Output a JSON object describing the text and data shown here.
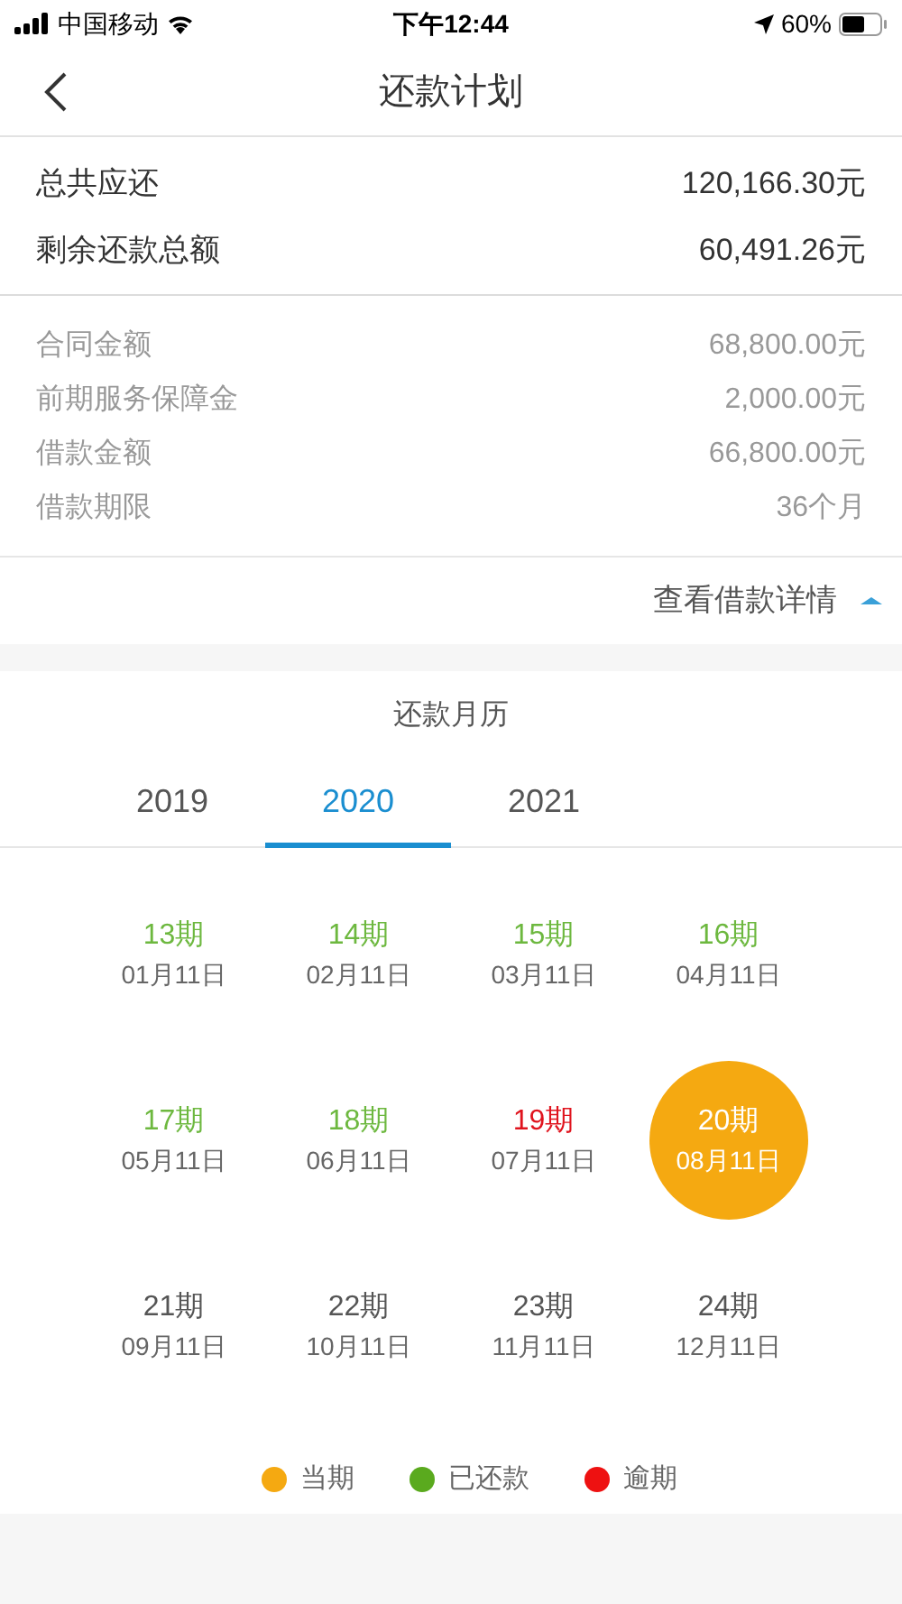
{
  "status_bar": {
    "carrier": "中国移动",
    "time": "下午12:44",
    "battery": "60%"
  },
  "nav": {
    "title": "还款计划"
  },
  "summary": [
    {
      "label": "总共应还",
      "value": "120,166.30元"
    },
    {
      "label": "剩余还款总额",
      "value": "60,491.26元"
    }
  ],
  "details": [
    {
      "label": "合同金额",
      "value": "68,800.00元"
    },
    {
      "label": "前期服务保障金",
      "value": "2,000.00元"
    },
    {
      "label": "借款金额",
      "value": "66,800.00元"
    },
    {
      "label": "借款期限",
      "value": "36个月"
    }
  ],
  "details_toggle": {
    "label": "查看借款详情",
    "expanded": true
  },
  "calendar": {
    "title": "还款月历",
    "years": [
      {
        "label": "2019",
        "selected": false
      },
      {
        "label": "2020",
        "selected": true
      },
      {
        "label": "2021",
        "selected": false
      }
    ],
    "periods": [
      {
        "term": "13期",
        "date": "01月11日",
        "kind": "paid"
      },
      {
        "term": "14期",
        "date": "02月11日",
        "kind": "paid"
      },
      {
        "term": "15期",
        "date": "03月11日",
        "kind": "paid"
      },
      {
        "term": "16期",
        "date": "04月11日",
        "kind": "paid"
      },
      {
        "term": "17期",
        "date": "05月11日",
        "kind": "paid"
      },
      {
        "term": "18期",
        "date": "06月11日",
        "kind": "paid"
      },
      {
        "term": "19期",
        "date": "07月11日",
        "kind": "overdue"
      },
      {
        "term": "20期",
        "date": "08月11日",
        "kind": "current"
      },
      {
        "term": "21期",
        "date": "09月11日",
        "kind": "upcoming"
      },
      {
        "term": "22期",
        "date": "10月11日",
        "kind": "upcoming"
      },
      {
        "term": "23期",
        "date": "11月11日",
        "kind": "upcoming"
      },
      {
        "term": "24期",
        "date": "12月11日",
        "kind": "upcoming"
      }
    ],
    "legend": [
      {
        "label": "当期",
        "color": "#f5a911"
      },
      {
        "label": "已还款",
        "color": "#5aaa1e"
      },
      {
        "label": "逾期",
        "color": "#ee1111"
      }
    ]
  }
}
